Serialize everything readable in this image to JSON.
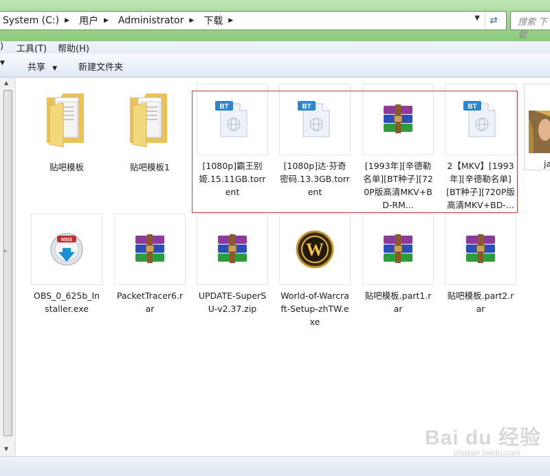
{
  "address": {
    "crumbs": [
      "System (C:)",
      "用户",
      "Administrator",
      "下载"
    ],
    "search_placeholder": "搜索 下载"
  },
  "menu": {
    "tools": "工具(T)",
    "help": "帮助(H)",
    "left_fragment": ")"
  },
  "toolbar": {
    "share": "共享",
    "new_folder": "新建文件夹"
  },
  "files": [
    {
      "name": "贴吧模板",
      "type": "folder"
    },
    {
      "name": "贴吧模板1",
      "type": "folder"
    },
    {
      "name": "[1080p]霸王别姬.15.11GB.torrent",
      "type": "torrent"
    },
    {
      "name": "[1080p]达·芬奇密码.13.3GB.torrent",
      "type": "torrent"
    },
    {
      "name": "[1993年][辛德勒名单][BT种子][720P版高清MKV+BD-RM...",
      "type": "archive"
    },
    {
      "name": "2【MKV】[1993年][辛德勒名单][BT种子][720P版高清MKV+BD-...",
      "type": "torrent"
    },
    {
      "name": "ja",
      "type": "image"
    },
    {
      "name": "OBS_0_625b_Installer.exe",
      "type": "installer"
    },
    {
      "name": "PacketTracer6.rar",
      "type": "archive"
    },
    {
      "name": "UPDATE-SuperSU-v2.37.zip",
      "type": "archive"
    },
    {
      "name": "World-of-Warcraft-Setup-zhTW.exe",
      "type": "wow"
    },
    {
      "name": "贴吧模板.part1.rar",
      "type": "archive"
    },
    {
      "name": "贴吧模板.part2.rar",
      "type": "archive"
    }
  ],
  "icon_text": {
    "bt_badge": "BT",
    "nsis_badge": "NSIS",
    "wow_letter": "W"
  },
  "watermark": {
    "brand": "Bai du 经验",
    "url": "jingyan.baidu.com"
  },
  "colors": {
    "address_green": "#9fd58f",
    "selection_red": "#c73b3b",
    "bt_blue": "#2e86cf"
  }
}
